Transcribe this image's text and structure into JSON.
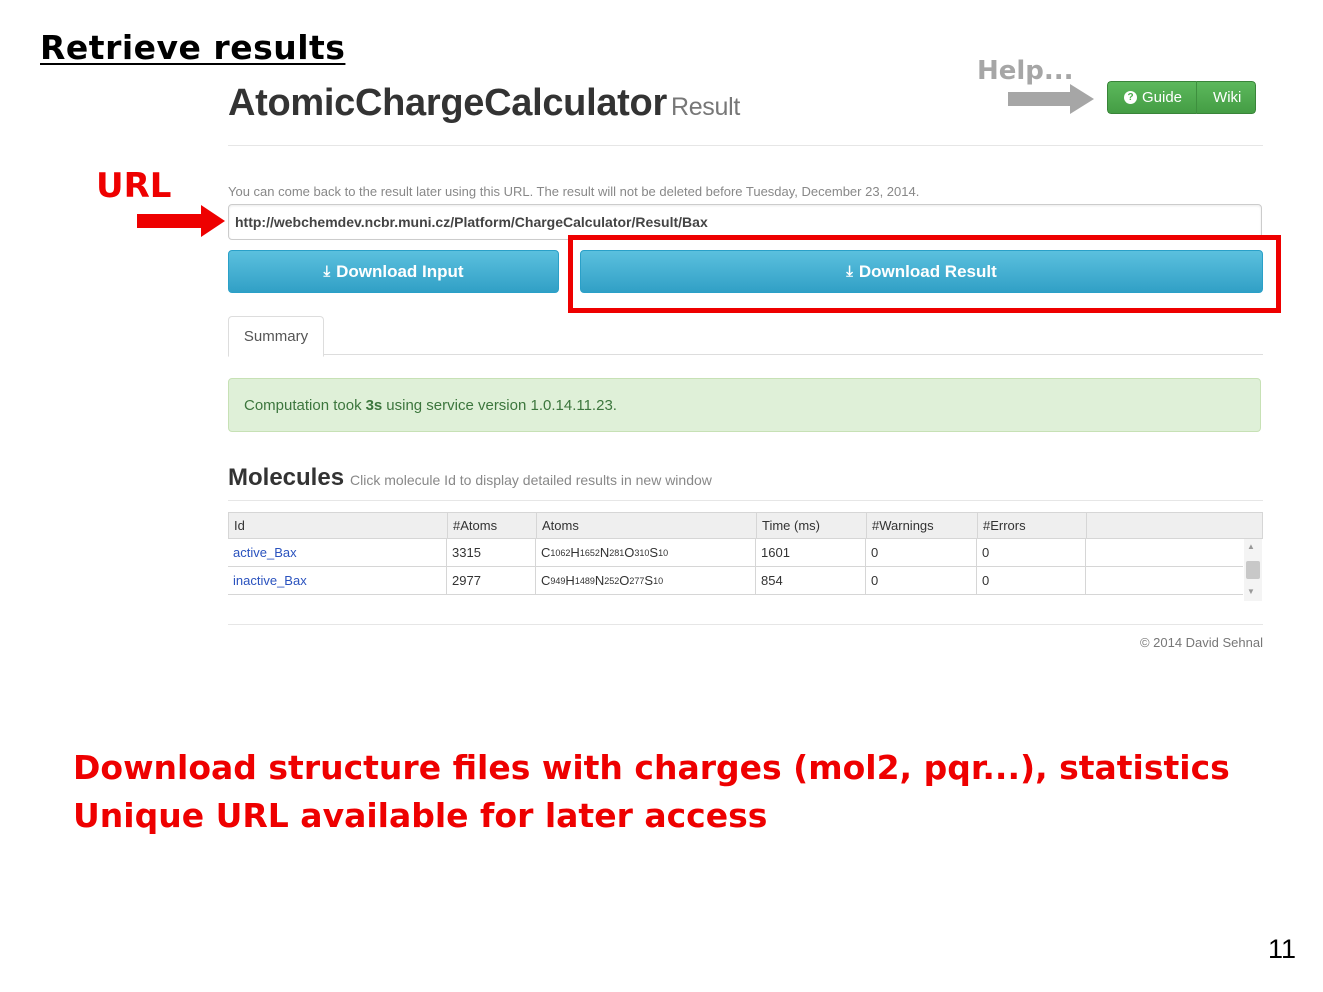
{
  "slide": {
    "title": "Retrieve results",
    "help_label": "Help...",
    "url_label": "URL",
    "bottom_line1": "Download structure files with charges (mol2, pqr...), statistics",
    "bottom_line2": "Unique URL available for later access",
    "page_number": "11",
    "accent_color": "#ee0000"
  },
  "header": {
    "app_name": "AtomicChargeCalculator",
    "app_sub": "Result",
    "guide_label": "Guide",
    "wiki_label": "Wiki"
  },
  "result": {
    "note": "You can come back to the result later using this URL. The result will not be deleted before Tuesday, December 23, 2014.",
    "url": "http://webchemdev.ncbr.muni.cz/Platform/ChargeCalculator/Result/Bax",
    "download_input_label": "Download Input",
    "download_result_label": "Download Result"
  },
  "tabs": {
    "summary_label": "Summary"
  },
  "alert": {
    "prefix": "Computation took",
    "duration": "3s",
    "suffix": "using service version 1.0.14.11.23."
  },
  "molecules": {
    "title": "Molecules",
    "hint": "Click molecule Id to display detailed results in new window",
    "columns": [
      "Id",
      "#Atoms",
      "Atoms",
      "Time (ms)",
      "#Warnings",
      "#Errors"
    ],
    "rows": [
      {
        "id": "active_Bax",
        "atoms_count": "3315",
        "formula": [
          [
            "C",
            "1062"
          ],
          [
            "H",
            "1652"
          ],
          [
            "N",
            "281"
          ],
          [
            "O",
            "310"
          ],
          [
            "S",
            "10"
          ]
        ],
        "time": "1601",
        "warnings": "0",
        "errors": "0"
      },
      {
        "id": "inactive_Bax",
        "atoms_count": "2977",
        "formula": [
          [
            "C",
            "949"
          ],
          [
            "H",
            "1489"
          ],
          [
            "N",
            "252"
          ],
          [
            "O",
            "277"
          ],
          [
            "S",
            "10"
          ]
        ],
        "time": "854",
        "warnings": "0",
        "errors": "0"
      }
    ]
  },
  "footer": {
    "copyright": "© 2014 David Sehnal"
  }
}
